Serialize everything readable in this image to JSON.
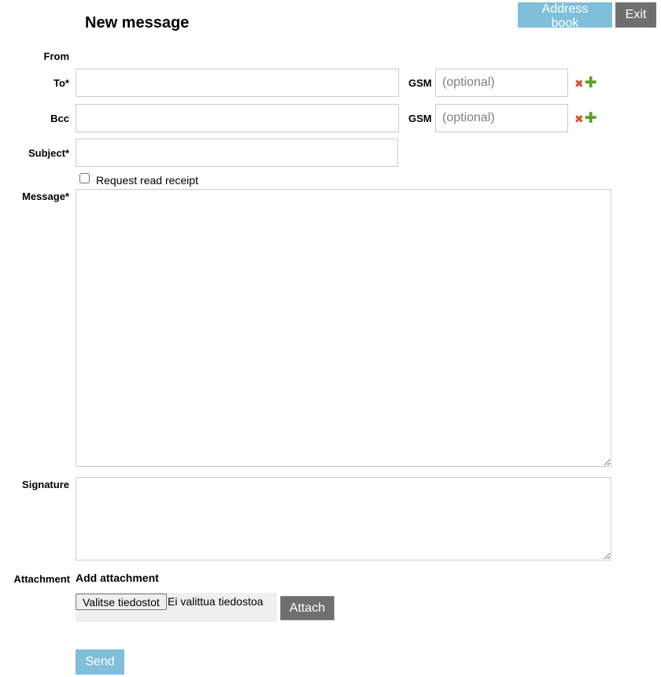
{
  "header": {
    "title": "New message",
    "address_book_label": "Address book",
    "exit_label": "Exit"
  },
  "form": {
    "from_label": "From",
    "to_label": "To*",
    "bcc_label": "Bcc",
    "subject_label": "Subject*",
    "message_label": "Message*",
    "signature_label": "Signature",
    "attachment_label": "Attachment",
    "gsm_label": "GSM",
    "gsm_placeholder": "(optional)",
    "to_value": "",
    "bcc_value": "",
    "subject_value": "",
    "message_value": "",
    "signature_value": "",
    "read_receipt_label": "Request read receipt",
    "read_receipt_checked": false
  },
  "attachment": {
    "heading": "Add attachment",
    "choose_files_label": "Valitse tiedostot",
    "no_files_text": "Ei valittua tiedostoa",
    "attach_label": "Attach"
  },
  "actions": {
    "send_label": "Send"
  },
  "icons": {
    "remove": "remove-icon",
    "add": "add-icon"
  },
  "colors": {
    "primary_button": "#7fbfd9",
    "secondary_button": "#6f6f6f",
    "remove_icon": "#d9512c",
    "add_icon": "#5aa02c"
  }
}
